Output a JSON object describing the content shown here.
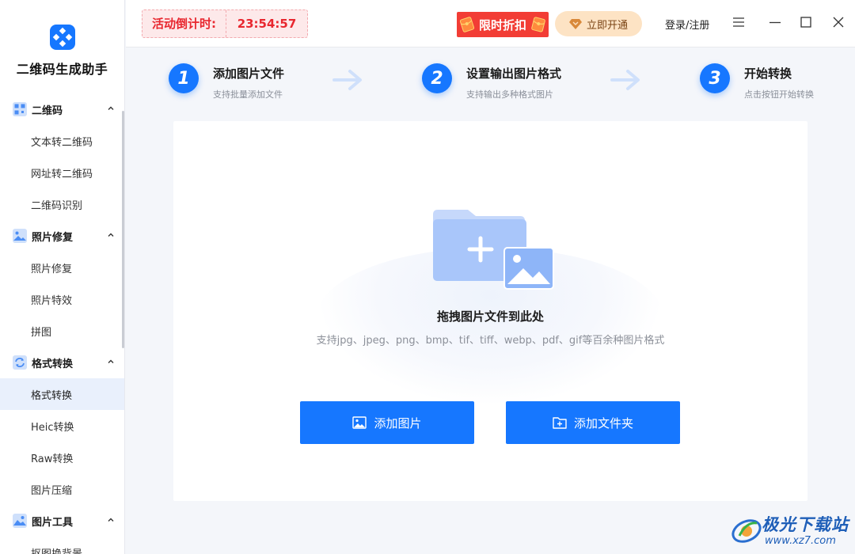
{
  "app": {
    "name": "二维码生成助手"
  },
  "sidebar": {
    "groups": [
      {
        "label": "二维码",
        "items": [
          "文本转二维码",
          "网址转二维码",
          "二维码识别"
        ]
      },
      {
        "label": "照片修复",
        "items": [
          "照片修复",
          "照片特效",
          "拼图"
        ]
      },
      {
        "label": "格式转换",
        "items": [
          "格式转换",
          "Heic转换",
          "Raw转换",
          "图片压缩"
        ]
      },
      {
        "label": "图片工具",
        "items": [
          "抠图换背景"
        ]
      }
    ],
    "active_item": "格式转换"
  },
  "topbar": {
    "countdown_label": "活动倒计时:",
    "countdown_time": "23:54:57",
    "promo_label": "限时折扣",
    "vip_label": "立即开通",
    "login_label": "登录/注册"
  },
  "steps": [
    {
      "num": "1",
      "title": "添加图片文件",
      "sub": "支持批量添加文件"
    },
    {
      "num": "2",
      "title": "设置输出图片格式",
      "sub": "支持输出多种格式图片"
    },
    {
      "num": "3",
      "title": "开始转换",
      "sub": "点击按钮开始转换"
    }
  ],
  "dropzone": {
    "title": "拖拽图片文件到此处",
    "subtitle": "支持jpg、jpeg、png、bmp、tif、tiff、webp、pdf、gif等百余种图片格式",
    "add_image_label": "添加图片",
    "add_folder_label": "添加文件夹"
  },
  "watermark": {
    "text": "极光下载站",
    "url": "www.xz7.com"
  },
  "colors": {
    "accent": "#1677ff",
    "promo_red": "#f23d35",
    "countdown_red": "#e8272f",
    "vip_bg": "#fde3c4"
  }
}
